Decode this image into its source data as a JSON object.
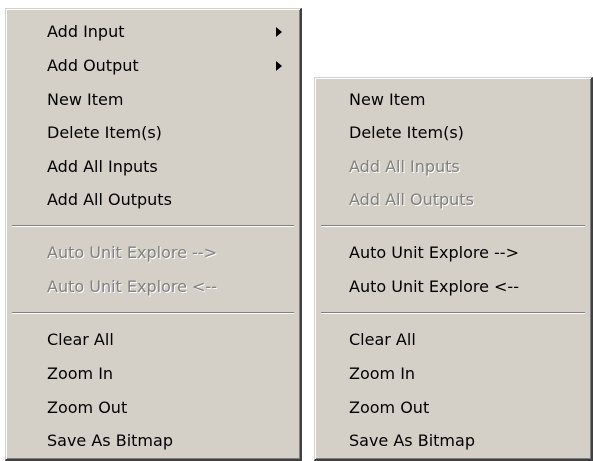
{
  "left_menu": {
    "items": [
      {
        "label": "Add Input",
        "submenu": true
      },
      {
        "label": "Add Output",
        "submenu": true
      },
      {
        "label": "New Item"
      },
      {
        "label": "Delete Item(s)"
      },
      {
        "label": "Add All Inputs"
      },
      {
        "label": "Add All Outputs"
      },
      {
        "label": "Auto Unit Explore -->",
        "disabled": true
      },
      {
        "label": "Auto Unit Explore <--",
        "disabled": true
      },
      {
        "label": "Clear All"
      },
      {
        "label": "Zoom In"
      },
      {
        "label": "Zoom Out"
      },
      {
        "label": "Save As Bitmap"
      }
    ]
  },
  "right_menu": {
    "items": [
      {
        "label": "New Item"
      },
      {
        "label": "Delete Item(s)"
      },
      {
        "label": "Add All Inputs",
        "disabled": true
      },
      {
        "label": "Add All Outputs",
        "disabled": true
      },
      {
        "label": "Auto Unit Explore -->"
      },
      {
        "label": "Auto Unit Explore <--"
      },
      {
        "label": "Clear All"
      },
      {
        "label": "Zoom In"
      },
      {
        "label": "Zoom Out"
      },
      {
        "label": "Save As Bitmap"
      }
    ]
  }
}
